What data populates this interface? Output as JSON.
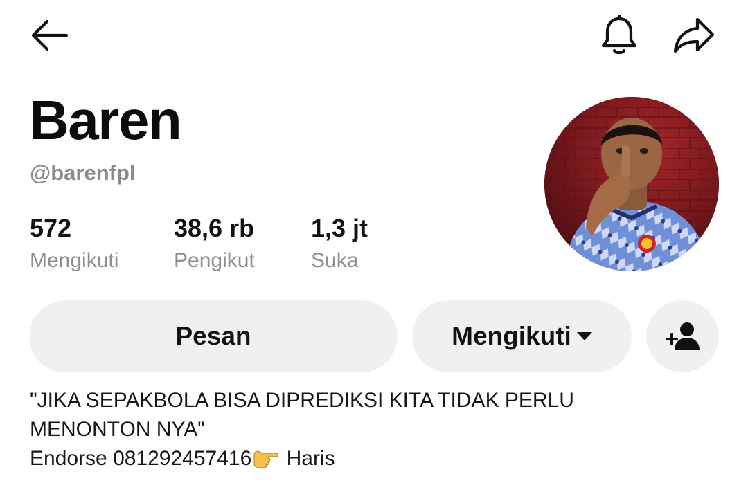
{
  "profile": {
    "display_name": "Baren",
    "username": "@barenfpl"
  },
  "stats": {
    "following": {
      "value": "572",
      "label": "Mengikuti"
    },
    "followers": {
      "value": "38,6 rb",
      "label": "Pengikut"
    },
    "likes": {
      "value": "1,3 jt",
      "label": "Suka"
    }
  },
  "actions": {
    "message_label": "Pesan",
    "following_label": "Mengikuti"
  },
  "bio": {
    "line1": "\"JIKA SEPAKBOLA BISA DIPREDIKSI KITA TIDAK PERLU",
    "line2": "MENONTON NYA\"",
    "line3_prefix": "Endorse 081292457416",
    "line3_suffix": " Haris"
  },
  "icons": {
    "back": "arrow-left-icon",
    "notification": "bell-icon",
    "share": "share-arrow-icon",
    "add_friend": "person-plus-icon",
    "pointing": "pointing-right-emoji"
  }
}
